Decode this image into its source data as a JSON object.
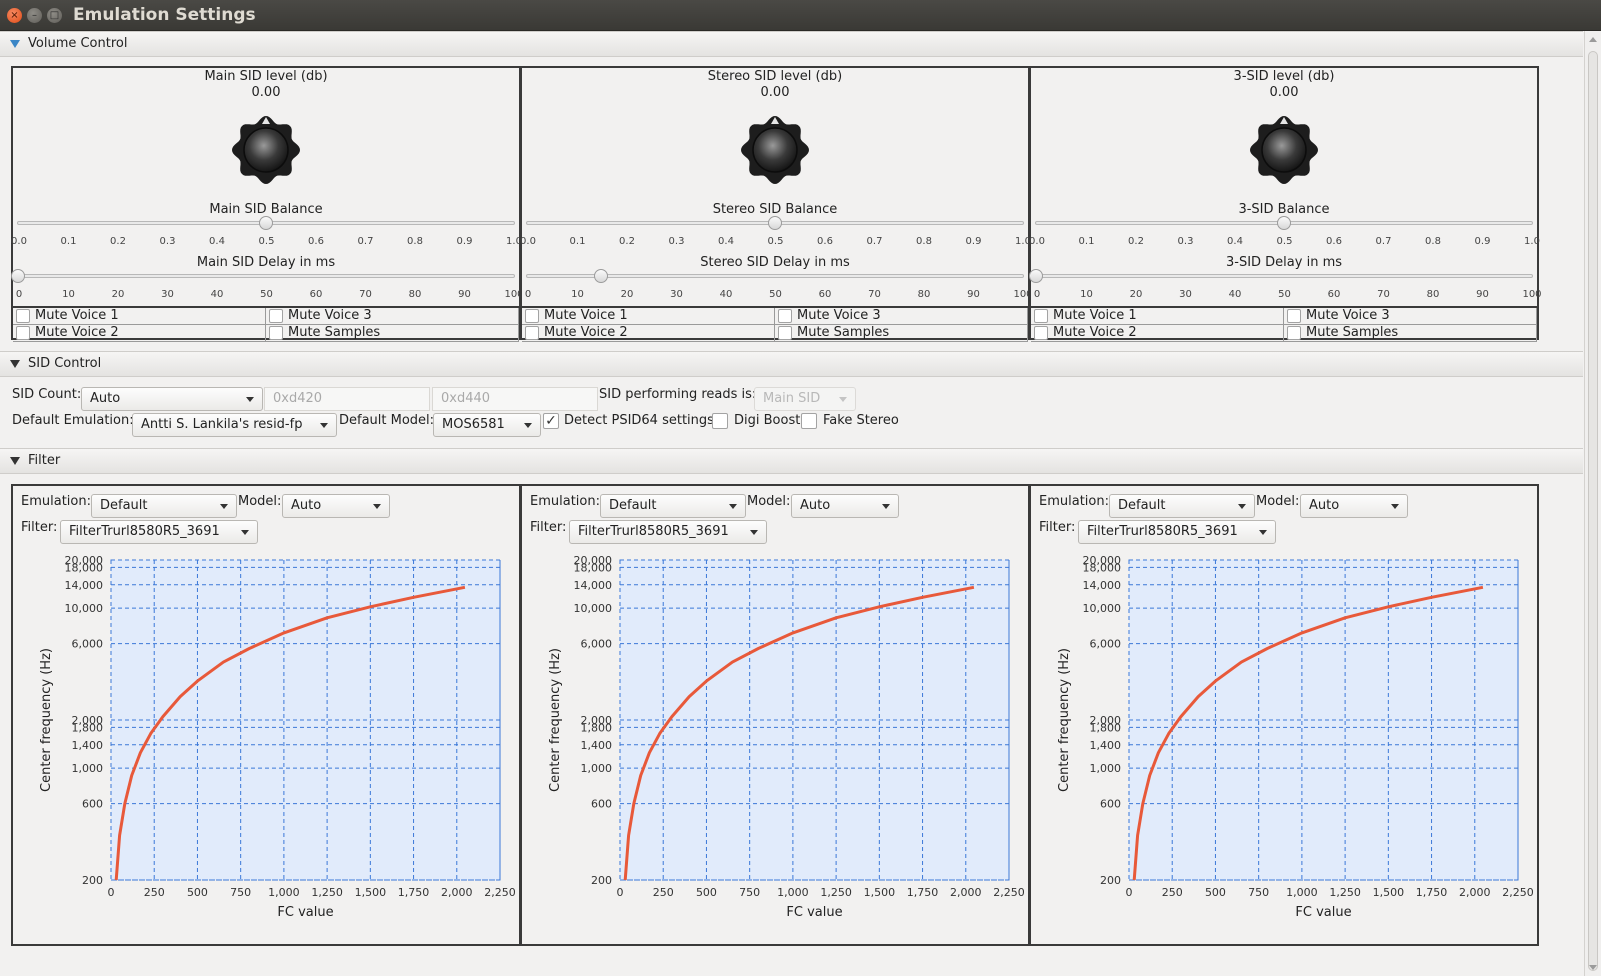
{
  "window": {
    "title": "Emulation Settings",
    "close_glyph": "×",
    "min_glyph": "–",
    "max_glyph": "□"
  },
  "sections": {
    "volume": {
      "label": "Volume Control"
    },
    "sid_control": {
      "label": "SID Control"
    },
    "filter": {
      "label": "Filter"
    }
  },
  "volume_panels": [
    {
      "level_label": "Main SID level (db)",
      "level_value": "0.00",
      "balance_label": "Main SID Balance",
      "balance_value": 0.5,
      "delay_label": "Main SID Delay in ms",
      "delay_value": 0,
      "mutes": [
        "Mute Voice 1",
        "Mute Voice 3",
        "Mute Voice 2",
        "Mute Samples"
      ]
    },
    {
      "level_label": "Stereo SID level (db)",
      "level_value": "0.00",
      "balance_label": "Stereo SID Balance",
      "balance_value": 0.5,
      "delay_label": "Stereo SID Delay in ms",
      "delay_value": 15,
      "mutes": [
        "Mute Voice 1",
        "Mute Voice 3",
        "Mute Voice 2",
        "Mute Samples"
      ]
    },
    {
      "level_label": "3-SID level (db)",
      "level_value": "0.00",
      "balance_label": "3-SID Balance",
      "balance_value": 0.5,
      "delay_label": "3-SID Delay in ms",
      "delay_value": 0,
      "mutes": [
        "Mute Voice 1",
        "Mute Voice 3",
        "Mute Voice 2",
        "Mute Samples"
      ]
    }
  ],
  "balance_ticks": [
    "0.0",
    "0.1",
    "0.2",
    "0.3",
    "0.4",
    "0.5",
    "0.6",
    "0.7",
    "0.8",
    "0.9",
    "1.0"
  ],
  "delay_ticks": [
    "0",
    "10",
    "20",
    "30",
    "40",
    "50",
    "60",
    "70",
    "80",
    "90",
    "100"
  ],
  "sid_control": {
    "sid_count_label": "SID Count:",
    "sid_count_value": "Auto",
    "addr2": "0xd420",
    "addr3": "0xd440",
    "reads_label": "SID performing reads is:",
    "reads_value": "Main SID",
    "default_emulation_label": "Default Emulation:",
    "default_emulation_value": "Antti S. Lankila's resid-fp",
    "default_model_label": "Default Model:",
    "default_model_value": "MOS6581",
    "detect_psid64_label": "Detect PSID64 settings",
    "detect_psid64_checked": true,
    "check_glyph": "✓",
    "digi_boost_label": "Digi Boost",
    "digi_boost_checked": false,
    "fake_stereo_label": "Fake Stereo",
    "fake_stereo_checked": false
  },
  "filter_panels": [
    {
      "emulation_label": "Emulation:",
      "emulation_value": "Default",
      "model_label": "Model:",
      "model_value": "Auto",
      "filter_label": "Filter:",
      "filter_value": "FilterTrurl8580R5_3691"
    },
    {
      "emulation_label": "Emulation:",
      "emulation_value": "Default",
      "model_label": "Model:",
      "model_value": "Auto",
      "filter_label": "Filter:",
      "filter_value": "FilterTrurl8580R5_3691"
    },
    {
      "emulation_label": "Emulation:",
      "emulation_value": "Default",
      "model_label": "Model:",
      "model_value": "Auto",
      "filter_label": "Filter:",
      "filter_value": "FilterTrurl8580R5_3691"
    }
  ],
  "chart_data": [
    {
      "type": "line",
      "xlabel": "FC value",
      "ylabel": "Center frequency (Hz)",
      "xlim": [
        0,
        2250
      ],
      "ylim": [
        200,
        20000
      ],
      "yscale": "log",
      "x_ticks": [
        "0",
        "250",
        "500",
        "750",
        "1,000",
        "1,250",
        "1,500",
        "1,750",
        "2,000",
        "2,250"
      ],
      "y_ticks": [
        "200",
        "600",
        "1,000",
        "1,400",
        "1,800",
        "2,000",
        "6,000",
        "10,000",
        "14,000",
        "18,000",
        "20,000"
      ],
      "grid": true,
      "line_color": "#e8593a",
      "bg_color": "#e1ebfb",
      "grid_color": "#3b78d8",
      "series": [
        {
          "x": [
            30,
            50,
            80,
            120,
            170,
            230,
            300,
            400,
            500,
            650,
            800,
            1000,
            1250,
            1500,
            1750,
            2047
          ],
          "y": [
            200,
            380,
            600,
            900,
            1250,
            1650,
            2100,
            2800,
            3500,
            4600,
            5600,
            7000,
            8700,
            10200,
            11700,
            13500
          ]
        }
      ]
    },
    {
      "type": "line",
      "xlabel": "FC value",
      "ylabel": "Center frequency (Hz)",
      "xlim": [
        0,
        2250
      ],
      "ylim": [
        200,
        20000
      ],
      "yscale": "log",
      "x_ticks": [
        "0",
        "250",
        "500",
        "750",
        "1,000",
        "1,250",
        "1,500",
        "1,750",
        "2,000",
        "2,250"
      ],
      "y_ticks": [
        "200",
        "600",
        "1,000",
        "1,400",
        "1,800",
        "2,000",
        "6,000",
        "10,000",
        "14,000",
        "18,000",
        "20,000"
      ],
      "grid": true,
      "line_color": "#e8593a",
      "bg_color": "#e1ebfb",
      "grid_color": "#3b78d8",
      "series": [
        {
          "x": [
            30,
            50,
            80,
            120,
            170,
            230,
            300,
            400,
            500,
            650,
            800,
            1000,
            1250,
            1500,
            1750,
            2047
          ],
          "y": [
            200,
            380,
            600,
            900,
            1250,
            1650,
            2100,
            2800,
            3500,
            4600,
            5600,
            7000,
            8700,
            10200,
            11700,
            13500
          ]
        }
      ]
    },
    {
      "type": "line",
      "xlabel": "FC value",
      "ylabel": "Center frequency (Hz)",
      "xlim": [
        0,
        2250
      ],
      "ylim": [
        200,
        20000
      ],
      "yscale": "log",
      "x_ticks": [
        "0",
        "250",
        "500",
        "750",
        "1,000",
        "1,250",
        "1,500",
        "1,750",
        "2,000",
        "2,250"
      ],
      "y_ticks": [
        "200",
        "600",
        "1,000",
        "1,400",
        "1,800",
        "2,000",
        "6,000",
        "10,000",
        "14,000",
        "18,000",
        "20,000"
      ],
      "grid": true,
      "line_color": "#e8593a",
      "bg_color": "#e1ebfb",
      "grid_color": "#3b78d8",
      "series": [
        {
          "x": [
            30,
            50,
            80,
            120,
            170,
            230,
            300,
            400,
            500,
            650,
            800,
            1000,
            1250,
            1500,
            1750,
            2047
          ],
          "y": [
            200,
            380,
            600,
            900,
            1250,
            1650,
            2100,
            2800,
            3500,
            4600,
            5600,
            7000,
            8700,
            10200,
            11700,
            13500
          ]
        }
      ]
    }
  ]
}
